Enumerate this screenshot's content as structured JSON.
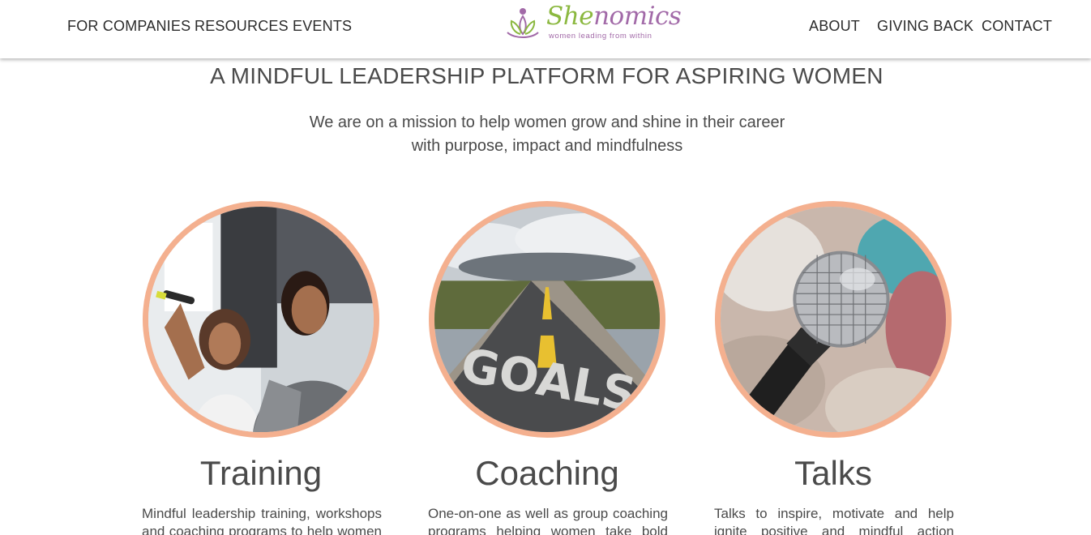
{
  "nav": {
    "left": [
      {
        "label": "FOR COMPANIES"
      },
      {
        "label": "RESOURCES"
      },
      {
        "label": "EVENTS"
      }
    ],
    "right": [
      {
        "label": "ABOUT"
      },
      {
        "label": "GIVING BACK"
      },
      {
        "label": "CONTACT"
      }
    ]
  },
  "logo": {
    "word_she": "She",
    "word_nomics": "nomics",
    "tagline": "women leading from within",
    "icon": "lotus-icon"
  },
  "hero": {
    "headline": "A MINDFUL LEADERSHIP PLATFORM FOR ASPIRING WOMEN",
    "subline_1": "We are on a mission to help women grow and shine in their career",
    "subline_2": "with purpose, impact and mindfulness"
  },
  "cards": [
    {
      "title": "Training",
      "text_1": "Mindful leadership training, workshops",
      "text_2": "and coaching programs to help women"
    },
    {
      "title": "Coaching",
      "text_1": "One-on-one as well as group coaching",
      "text_2": "programs helping women take bold"
    },
    {
      "title": "Talks",
      "text_1": "Talks to inspire, motivate and help",
      "text_2": "ignite positive and mindful action"
    }
  ],
  "colors": {
    "accent_border": "#f4b08f",
    "logo_green": "#8bb83f",
    "logo_purple": "#a26aa8",
    "text": "#4a4a4a"
  }
}
